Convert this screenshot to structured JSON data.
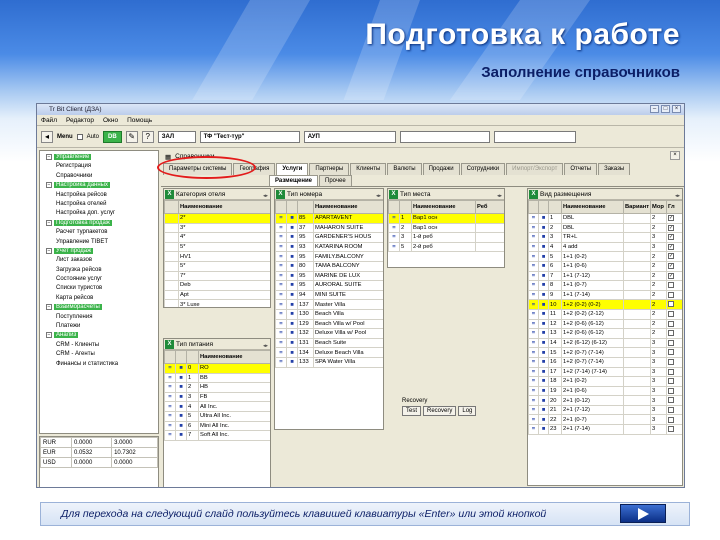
{
  "slide": {
    "title": "Подготовка к работе",
    "subtitle": "Заполнение справочников",
    "footer_text": "Для перехода на следующий слайд пользуйтесь клавишей клавиатуры «Enter» или этой кнопкой",
    "next_icon": "play-triangle-icon",
    "accent": "#2f6dd0"
  },
  "app": {
    "window_title": "Tr Bit Client (ДЗА)",
    "menu": [
      "Файл",
      "Редактор",
      "Окно",
      "Помощь"
    ],
    "toolbar": {
      "menu_label": "Menu",
      "auto_label": "Auto",
      "db_label": "DB",
      "field1": "ЗАЛ",
      "field2": "ТФ \"Тест-тур\"",
      "field3": "АУП"
    },
    "tree": [
      {
        "label": "Управление",
        "group": true
      },
      {
        "label": "Регистрация",
        "group": false
      },
      {
        "label": "Справочники",
        "group": false
      },
      {
        "label": "Настройка данных",
        "group": true
      },
      {
        "label": "Настройка рейсов",
        "group": false
      },
      {
        "label": "Настройка отелей",
        "group": false
      },
      {
        "label": "Настройка доп. услуг",
        "group": false
      },
      {
        "label": "Подготовка продаж",
        "group": true
      },
      {
        "label": "Расчет турпакетов",
        "group": false
      },
      {
        "label": "Управление TIBET",
        "group": false
      },
      {
        "label": "Учет продаж",
        "group": true
      },
      {
        "label": "Лист заказов",
        "group": false
      },
      {
        "label": "Загрузка рейсов",
        "group": false
      },
      {
        "label": "Состояние услуг",
        "group": false
      },
      {
        "label": "Списки туристов",
        "group": false
      },
      {
        "label": "Карта рейсов",
        "group": false
      },
      {
        "label": "Взаиморасчеты",
        "group": true
      },
      {
        "label": "Поступления",
        "group": false
      },
      {
        "label": "Платежи",
        "group": false
      },
      {
        "label": "Анализ",
        "group": true
      },
      {
        "label": "CRM - Клиенты",
        "group": false
      },
      {
        "label": "CRM - Агенты",
        "group": false
      },
      {
        "label": "Финансы и статистика",
        "group": false
      }
    ],
    "currency": [
      [
        "RUR",
        "0.0000",
        "3.0000"
      ],
      [
        "EUR",
        "0.0532",
        "10.7302"
      ],
      [
        "USD",
        "0.0000",
        "0.0000"
      ]
    ],
    "breadcrumb": "Справочники",
    "tabs_row1": [
      {
        "label": "Параметры системы",
        "state": "normal"
      },
      {
        "label": "География",
        "state": "normal"
      },
      {
        "label": "Услуги",
        "state": "active"
      },
      {
        "label": "Партнеры",
        "state": "normal"
      },
      {
        "label": "Клиенты",
        "state": "normal"
      },
      {
        "label": "Валюты",
        "state": "normal"
      },
      {
        "label": "Продажи",
        "state": "normal"
      },
      {
        "label": "Сотрудники",
        "state": "normal"
      },
      {
        "label": "Импорт/Экспорт",
        "state": "disabled"
      },
      {
        "label": "Отчеты",
        "state": "normal"
      },
      {
        "label": "Заказы",
        "state": "normal"
      }
    ],
    "tabs_row2": [
      {
        "label": "Размещение",
        "state": "active"
      },
      {
        "label": "Прочее",
        "state": "normal"
      }
    ],
    "cat_grid": {
      "title": "Категория отеля",
      "headers": [
        "",
        "Наименование"
      ],
      "rows": [
        [
          "",
          "2*"
        ],
        [
          "",
          "3*"
        ],
        [
          "",
          "4*"
        ],
        [
          "",
          "5*"
        ],
        [
          "",
          "HV1"
        ],
        [
          "",
          "5*"
        ],
        [
          "",
          "7*"
        ],
        [
          "",
          "Deb"
        ],
        [
          "",
          "Apt"
        ],
        [
          "",
          "3* Luxe"
        ]
      ],
      "selected": 0
    },
    "room_grid": {
      "title": "Тип номера",
      "headers": [
        "",
        "",
        "",
        "Наименование"
      ],
      "rows": [
        [
          "=",
          "■",
          "85",
          "APARTAVENT"
        ],
        [
          "=",
          "■",
          "37",
          "MAHARON SUITE"
        ],
        [
          "=",
          "■",
          "95",
          "GARDENER'S HOUS"
        ],
        [
          "=",
          "■",
          "93",
          "KATARINA ROOM"
        ],
        [
          "=",
          "■",
          "95",
          "FAMILY.BALCONY"
        ],
        [
          "=",
          "■",
          "80",
          "TAMA BALCONY"
        ],
        [
          "=",
          "■",
          "95",
          "MARINE DE LUX"
        ],
        [
          "=",
          "■",
          "95",
          "AURORAL SUITE"
        ],
        [
          "=",
          "■",
          "94",
          "MINI SUITE"
        ],
        [
          "=",
          "■",
          "137",
          "Master Villa"
        ],
        [
          "=",
          "■",
          "130",
          "Beach Villa"
        ],
        [
          "=",
          "■",
          "129",
          "Beach Villa w/ Pool"
        ],
        [
          "=",
          "■",
          "132",
          "Deluxe Villa w/ Pool"
        ],
        [
          "=",
          "■",
          "131",
          "Beach Suite"
        ],
        [
          "=",
          "■",
          "134",
          "Deluxe Beach Villa"
        ],
        [
          "=",
          "■",
          "133",
          "SPA Water Villa"
        ]
      ],
      "selected": 0
    },
    "beds_grid": {
      "title": "Тип места",
      "headers": [
        "",
        "",
        "Наименование",
        "Реб"
      ],
      "rows": [
        [
          "=",
          "1",
          "Вар1 осн",
          ""
        ],
        [
          "=",
          "2",
          "Вар1 осн",
          ""
        ],
        [
          "=",
          "3",
          "1-й реб",
          ""
        ],
        [
          "=",
          "5",
          "2-й реб",
          ""
        ]
      ],
      "selected": 0
    },
    "recovery": {
      "label": "Recovery",
      "buttons": [
        "Test",
        "Recovery",
        "Log"
      ]
    },
    "food_grid": {
      "title": "Тип питания",
      "headers": [
        "",
        "",
        "",
        "Наименование"
      ],
      "rows": [
        [
          "=",
          "■",
          "0",
          "RO"
        ],
        [
          "=",
          "■",
          "1",
          "BB"
        ],
        [
          "=",
          "■",
          "2",
          "HB"
        ],
        [
          "=",
          "■",
          "3",
          "FB"
        ],
        [
          "=",
          "■",
          "4",
          "All Inc."
        ],
        [
          "=",
          "■",
          "5",
          "Ultra All Inc."
        ],
        [
          "=",
          "■",
          "6",
          "Mini All Inc."
        ],
        [
          "=",
          "■",
          "7",
          "Soft All Inc."
        ]
      ],
      "selected": 0
    },
    "accom_grid": {
      "title": "Вид размещения",
      "headers": [
        "",
        "",
        "",
        "Наименование",
        "Вариант",
        "Мор",
        "Гл"
      ],
      "rows": [
        [
          "=",
          "■",
          "1",
          "DBL",
          "",
          "2",
          true
        ],
        [
          "=",
          "■",
          "2",
          "DBL",
          "",
          "2",
          true
        ],
        [
          "=",
          "■",
          "3",
          "TR+L",
          "",
          "3",
          true
        ],
        [
          "=",
          "■",
          "4",
          "4 add",
          "",
          "3",
          true
        ],
        [
          "=",
          "■",
          "5",
          "1+1 (0-2)",
          "",
          "2",
          true
        ],
        [
          "=",
          "■",
          "6",
          "1+1 (0-6)",
          "",
          "2",
          true
        ],
        [
          "=",
          "■",
          "7",
          "1+1 (7-12)",
          "",
          "2",
          true
        ],
        [
          "=",
          "■",
          "8",
          "1+1 (0-7)",
          "",
          "2",
          false
        ],
        [
          "=",
          "■",
          "9",
          "1+1 (7-14)",
          "",
          "2",
          false
        ],
        [
          "=",
          "■",
          "10",
          "1+2 (0-2) (0-2)",
          "",
          "2",
          false
        ],
        [
          "=",
          "■",
          "11",
          "1+2 (0-2) (2-12)",
          "",
          "2",
          false
        ],
        [
          "=",
          "■",
          "12",
          "1+2 (0-6) (6-12)",
          "",
          "2",
          false
        ],
        [
          "=",
          "■",
          "13",
          "1+2 (0-6) (6-12)",
          "",
          "2",
          false
        ],
        [
          "=",
          "■",
          "14",
          "1+2 (6-12) (6-12)",
          "",
          "3",
          false
        ],
        [
          "=",
          "■",
          "15",
          "1+2 (0-7) (7-14)",
          "",
          "3",
          false
        ],
        [
          "=",
          "■",
          "16",
          "1+2 (0-7) (7-14)",
          "",
          "3",
          false
        ],
        [
          "=",
          "■",
          "17",
          "1+2 (7-14) (7-14)",
          "",
          "3",
          false
        ],
        [
          "=",
          "■",
          "18",
          "2+1 (0-2)",
          "",
          "3",
          false
        ],
        [
          "=",
          "■",
          "19",
          "2+1 (0-6)",
          "",
          "3",
          false
        ],
        [
          "=",
          "■",
          "20",
          "2+1 (0-12)",
          "",
          "3",
          false
        ],
        [
          "=",
          "■",
          "21",
          "2+1 (7-12)",
          "",
          "3",
          false
        ],
        [
          "=",
          "■",
          "22",
          "2+1 (0-7)",
          "",
          "3",
          false
        ],
        [
          "=",
          "■",
          "23",
          "2+1 (7-14)",
          "",
          "3",
          false
        ]
      ],
      "selected": 9
    }
  }
}
